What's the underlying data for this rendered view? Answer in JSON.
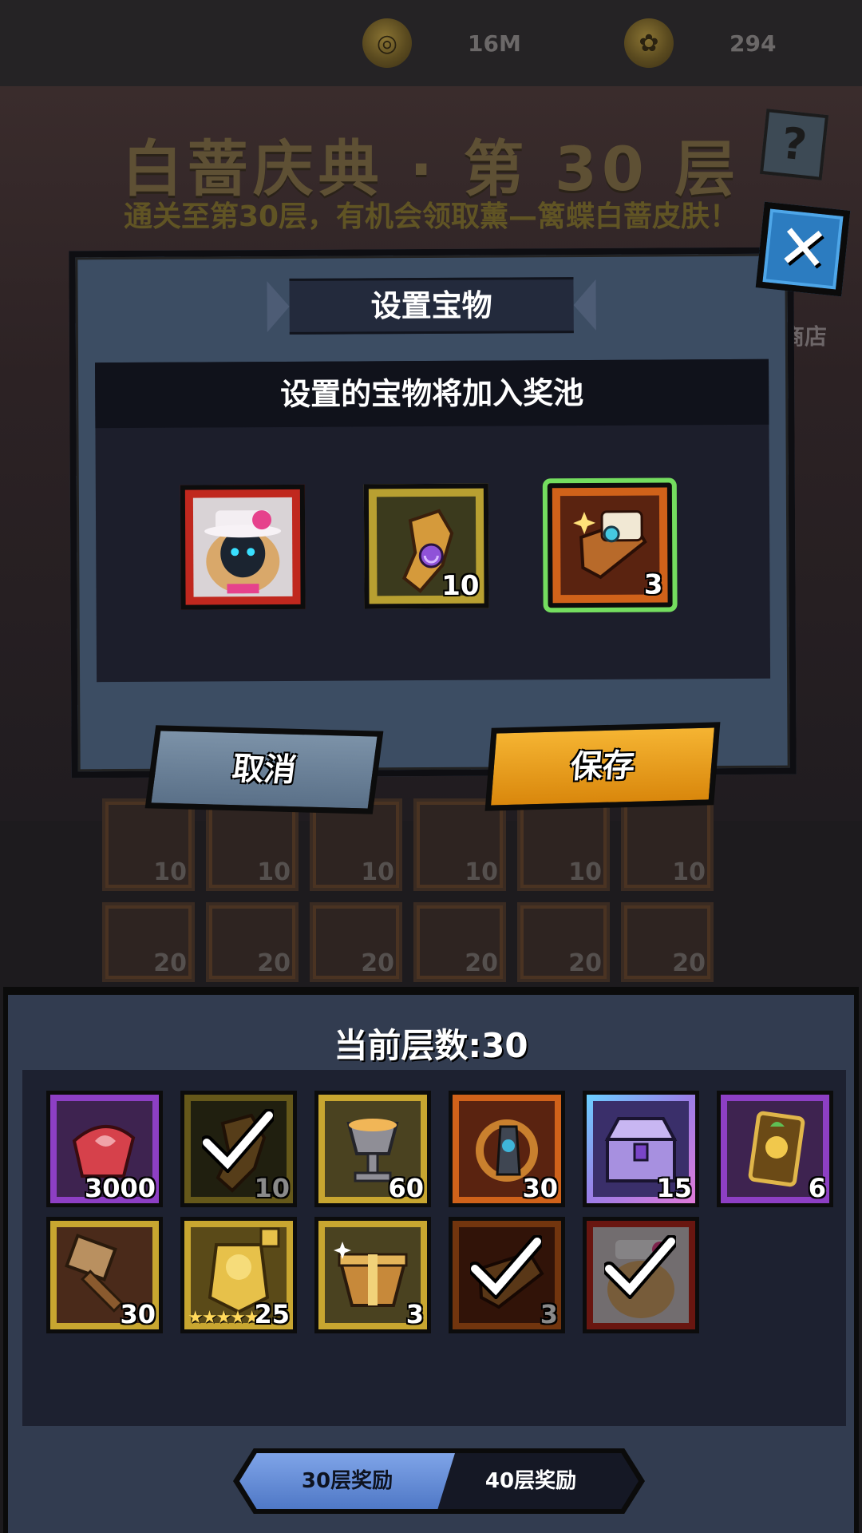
{
  "topbar": {
    "currency1": {
      "icon": "coin-icon",
      "value": "16M"
    },
    "currency2": {
      "icon": "cake-token-icon",
      "value": "294"
    }
  },
  "background": {
    "event_title": "白蔷庆典 · 第 30 层",
    "event_subtitle": "通关至第30层，有机会领取薰—篱蝶白蔷皮肤！",
    "help_icon": "question-icon",
    "shop_label": "商店",
    "ghost_row1_qty": [
      "10",
      "10",
      "10",
      "10",
      "10",
      "10"
    ],
    "ghost_row2_qty": [
      "20",
      "20",
      "20",
      "20",
      "20",
      "20"
    ]
  },
  "modal": {
    "title": "设置宝物",
    "panel_header": "设置的宝物将加入奖池",
    "slots": [
      {
        "name": "white-rose-skin",
        "qty": "",
        "frame": "#c0281e",
        "selected": false
      },
      {
        "name": "golden-gauntlet",
        "qty": "10",
        "frame": "#b8a031",
        "selected": false
      },
      {
        "name": "treasure-scroll",
        "qty": "3",
        "frame": "#d0621a",
        "selected": true
      }
    ],
    "cancel_label": "取消",
    "save_label": "保存",
    "close_icon": "close-icon"
  },
  "rewards": {
    "floor_label": "当前层数:30",
    "items": [
      {
        "icon": "rose-gem-icon",
        "qty": "3000",
        "frame": "#8d3fc4",
        "claimed": false
      },
      {
        "icon": "gauntlet-icon",
        "qty": "10",
        "frame": "#b8a031",
        "claimed": true
      },
      {
        "icon": "goblet-icon",
        "qty": "60",
        "frame": "#c8a630",
        "claimed": false
      },
      {
        "icon": "amulet-icon",
        "qty": "30",
        "frame": "#d0621a",
        "claimed": false
      },
      {
        "icon": "treasure-chest-icon",
        "qty": "15",
        "frame": "#9c7de6",
        "claimed": false
      },
      {
        "icon": "hero-card-icon",
        "qty": "6",
        "frame": "#8d3fc4",
        "claimed": false
      },
      {
        "icon": "hammer-icon",
        "qty": "30",
        "frame": "#c8a630",
        "claimed": false
      },
      {
        "icon": "hero-shard-icon",
        "qty": "25",
        "frame": "#c8a630",
        "claimed": false,
        "stars": "★★★★★"
      },
      {
        "icon": "gift-box-icon",
        "qty": "3",
        "frame": "#c8a630",
        "claimed": false
      },
      {
        "icon": "scroll-icon",
        "qty": "3",
        "frame": "#d0621a",
        "claimed": true
      },
      {
        "icon": "skin-icon",
        "qty": "",
        "frame": "#c0281e",
        "claimed": true
      }
    ],
    "tabs": [
      {
        "label": "30层奖励",
        "active": true
      },
      {
        "label": "40层奖励",
        "active": false
      }
    ]
  }
}
